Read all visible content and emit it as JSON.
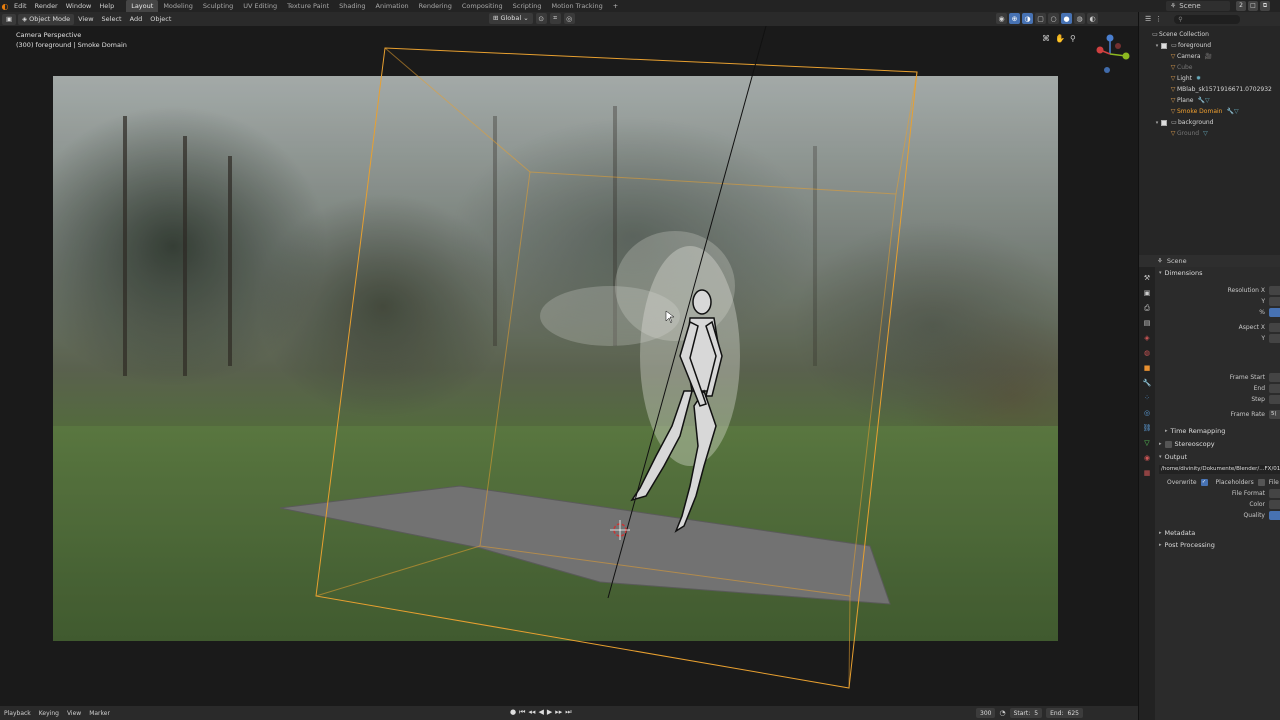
{
  "menubar": {
    "items": [
      "Edit",
      "Render",
      "Window",
      "Help"
    ],
    "workspaces": [
      "Layout",
      "Modeling",
      "Sculpting",
      "UV Editing",
      "Texture Paint",
      "Shading",
      "Animation",
      "Rendering",
      "Compositing",
      "Scripting",
      "Motion Tracking"
    ],
    "active_workspace": "Layout",
    "add_tab": "+",
    "scene_name": "Scene",
    "window_buttons": [
      "2",
      "□",
      "⧉"
    ]
  },
  "viewport_header": {
    "mode": "Object Mode",
    "menus": [
      "View",
      "Select",
      "Add",
      "Object"
    ],
    "orientation": "Global"
  },
  "viewport": {
    "camera_label": "Camera Perspective",
    "object_label": "(300) foreground | Smoke Domain"
  },
  "outliner": {
    "collection": "Scene Collection",
    "rows": [
      {
        "name": "foreground",
        "type": "collection",
        "state": "normal",
        "indent": 1
      },
      {
        "name": "Camera",
        "type": "object",
        "state": "normal",
        "indent": 2
      },
      {
        "name": "Cube",
        "type": "object",
        "state": "dim",
        "indent": 2
      },
      {
        "name": "Light",
        "type": "object",
        "state": "normal",
        "indent": 2
      },
      {
        "name": "MBlab_sk1571916671.0702932",
        "type": "object",
        "state": "normal",
        "indent": 2
      },
      {
        "name": "Plane",
        "type": "object",
        "state": "normal",
        "indent": 2
      },
      {
        "name": "Smoke Domain",
        "type": "object",
        "state": "selected",
        "indent": 2
      },
      {
        "name": "background",
        "type": "collection",
        "state": "normal",
        "indent": 1
      },
      {
        "name": "Ground",
        "type": "object",
        "state": "dim",
        "indent": 2
      }
    ]
  },
  "properties": {
    "context": "Scene",
    "dimensions_title": "Dimensions",
    "resolution_x": "Resolution X",
    "y1": "Y",
    "percent": "%",
    "aspect_x": "Aspect X",
    "y2": "Y",
    "frame_start": "Frame Start",
    "end": "End",
    "step": "Step",
    "frame_rate": "Frame Rate",
    "frame_rate_value": "5(",
    "time_remapping": "Time Remapping",
    "stereoscopy": "Stereoscopy",
    "output_title": "Output",
    "output_path": "/home/divinity/Dokumente/Blender/...FX/01",
    "overwrite": "Overwrite",
    "placeholders": "Placeholders",
    "file_ext": "File",
    "file_format": "File Format",
    "color": "Color",
    "quality": "Quality",
    "metadata": "Metadata",
    "post_processing": "Post Processing"
  },
  "timeline": {
    "menus": [
      "Playback",
      "Keying",
      "View",
      "Marker"
    ],
    "current_frame": "300",
    "start_label": "Start:",
    "start_value": "5",
    "end_label": "End:",
    "end_value": "625"
  },
  "colors": {
    "accent": "#4772b3",
    "orange": "#e8a030",
    "brand": "#e87d0d"
  }
}
